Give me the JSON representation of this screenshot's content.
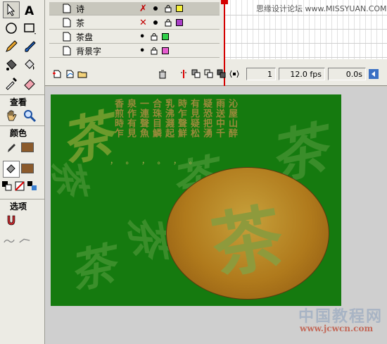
{
  "watermark_top": "思缘设计论坛  www.MISSYUAN.COM",
  "tools": {
    "section_view": "查看",
    "section_colors": "颜色",
    "section_options": "选项"
  },
  "layers": [
    {
      "name": "诗",
      "marker": "✗",
      "color": "#f5ef3a"
    },
    {
      "name": "茶",
      "marker": "✕",
      "color": "#a93ec7"
    },
    {
      "name": "茶盘",
      "marker": "•",
      "color": "#31d04a"
    },
    {
      "name": "背景字",
      "marker": "•",
      "color": "#e65ccf"
    }
  ],
  "timeline": {
    "current_frame": "1",
    "fps": "12.0 fps",
    "time": "0.0s"
  },
  "stage": {
    "poem_columns": [
      "香煎時乍",
      "泉作有見",
      "一連聲魚",
      "合珠目鱗",
      "乳沸濺起",
      "時乍聲鮮",
      "有見疑松",
      "疑恐把湧",
      "雨送中千",
      "沁屋山醉"
    ],
    "poem_dots": "， 。 ， 。 ， 。",
    "center_char": "茶",
    "bg_char": "茶"
  },
  "watermark_bottom": {
    "cn": "中国教程网",
    "url": "www.jcwcn.com"
  }
}
